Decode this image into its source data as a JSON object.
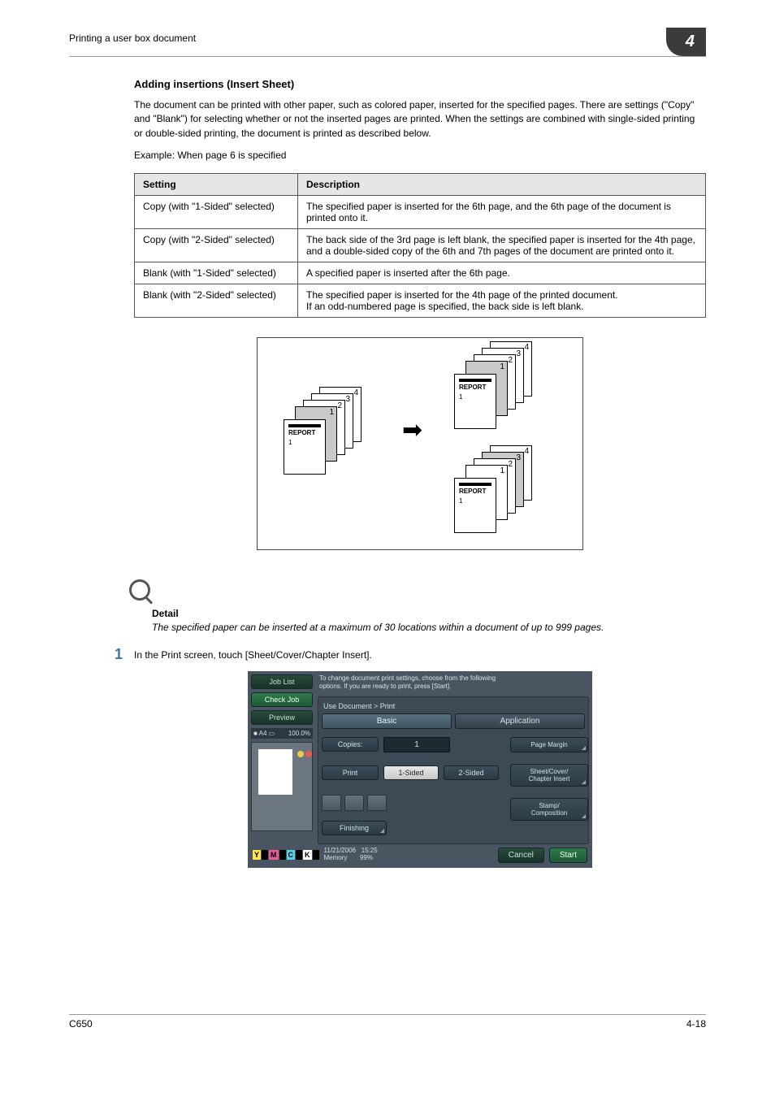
{
  "header": {
    "section": "Printing a user box document",
    "chapter": "4"
  },
  "title": "Adding insertions (Insert Sheet)",
  "intro": "The document can be printed with other paper, such as colored paper, inserted for the specified pages. There are settings (\"Copy\" and \"Blank\") for selecting whether or not the inserted pages are printed. When the settings are combined with single-sided printing or double-sided printing, the document is printed as described below.",
  "example": "Example: When page 6 is specified",
  "table": {
    "head": [
      "Setting",
      "Description"
    ],
    "rows": [
      [
        "Copy (with \"1-Sided\" selected)",
        "The specified paper is inserted for the 6th page, and the 6th page of the document is printed onto it."
      ],
      [
        "Copy (with \"2-Sided\" selected)",
        "The back side of the 3rd page is left blank, the specified paper is inserted for the 4th page, and a double-sided copy of the 6th and 7th pages of the document are printed onto it."
      ],
      [
        "Blank (with \"1-Sided\" selected)",
        "A specified paper is inserted after the 6th page."
      ],
      [
        "Blank (with \"2-Sided\" selected)",
        "The specified paper is inserted for the 4th page of the printed document.\nIf an odd-numbered page is specified, the back side is left blank."
      ]
    ]
  },
  "diagram": {
    "report": "REPORT",
    "one": "1"
  },
  "detail": {
    "label": "Detail",
    "text": "The specified paper can be inserted at a maximum of 30 locations within a document of up to 999 pages."
  },
  "step": {
    "num": "1",
    "text": "In the Print screen, touch [Sheet/Cover/Chapter Insert]."
  },
  "panel": {
    "jobList": "Job List",
    "checkJob": "Check Job",
    "preview": "Preview",
    "psize": "A4",
    "zoom": "100.0%",
    "status": "To change document print settings, choose from the following\noptions. If you are ready to print, press [Start].",
    "breadcrumb": "Use Document > Print",
    "tabBasic": "Basic",
    "tabApp": "Application",
    "copies": "Copies:",
    "copiesVal": "1",
    "print": "Print",
    "oneSided": "1-Sided",
    "twoSided": "2-Sided",
    "finishing": "Finishing",
    "pageMargin": "Page Margin",
    "sheetCover": "Sheet/Cover/\nChapter Insert",
    "stamp": "Stamp/\nComposition",
    "date": "11/21/2006",
    "time": "15:25",
    "memory": "Memory",
    "mempct": "99%",
    "cancel": "Cancel",
    "start": "Start"
  },
  "footer": {
    "model": "C650",
    "page": "4-18"
  }
}
